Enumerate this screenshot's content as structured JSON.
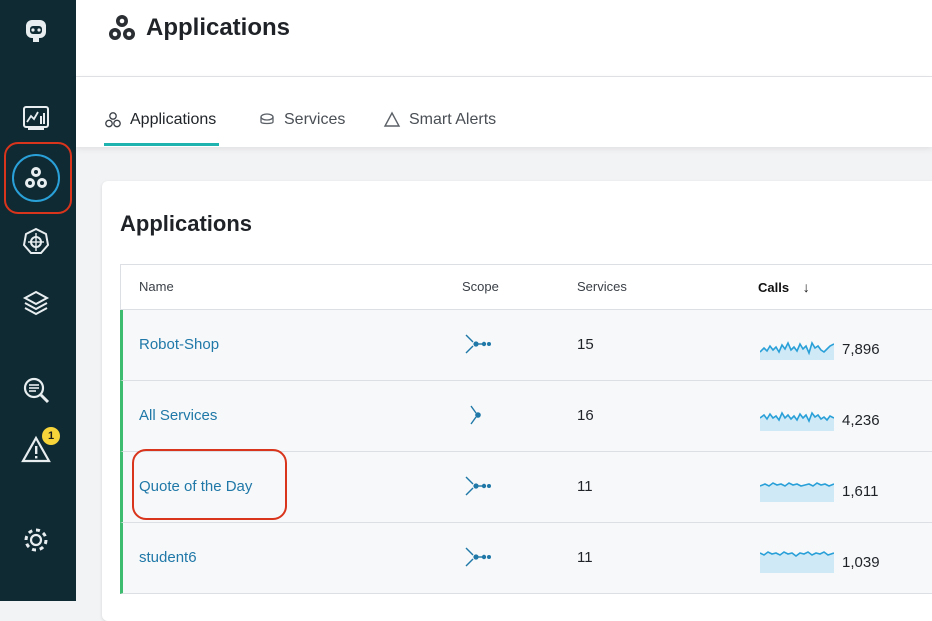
{
  "header": {
    "title": "Applications"
  },
  "tabs": [
    {
      "label": "Applications",
      "icon": "applications-icon",
      "active": true
    },
    {
      "label": "Services",
      "icon": "services-icon",
      "active": false
    },
    {
      "label": "Smart Alerts",
      "icon": "smart-alerts-icon",
      "active": false
    }
  ],
  "sidebar": {
    "items": [
      {
        "name": "logo",
        "icon": "robot-logo-icon"
      },
      {
        "name": "dashboards",
        "icon": "dashboard-icon"
      },
      {
        "name": "applications",
        "icon": "applications-icon",
        "active": true
      },
      {
        "name": "kubernetes",
        "icon": "kubernetes-icon"
      },
      {
        "name": "infrastructure",
        "icon": "layers-icon"
      },
      {
        "name": "analytics",
        "icon": "search-analytics-icon"
      },
      {
        "name": "events",
        "icon": "warning-icon",
        "badge": "1"
      },
      {
        "name": "settings",
        "icon": "gear-icon"
      }
    ]
  },
  "card": {
    "title": "Applications",
    "columns": {
      "name": "Name",
      "scope": "Scope",
      "services": "Services",
      "calls": "Calls",
      "sort_indicator": "↓"
    },
    "rows": [
      {
        "name": "Robot-Shop",
        "services": "15",
        "calls": "7,896"
      },
      {
        "name": "All Services",
        "services": "16",
        "calls": "4,236"
      },
      {
        "name": "Quote of the Day",
        "services": "11",
        "calls": "1,611"
      },
      {
        "name": "student6",
        "services": "11",
        "calls": "1,039"
      }
    ]
  },
  "colors": {
    "sidebar": "#0f2a33",
    "accent": "#1fb3b0",
    "link": "#1f78a8",
    "row_marker": "#3dbb6f",
    "highlight": "#d9341c",
    "badge": "#f6d43a"
  }
}
